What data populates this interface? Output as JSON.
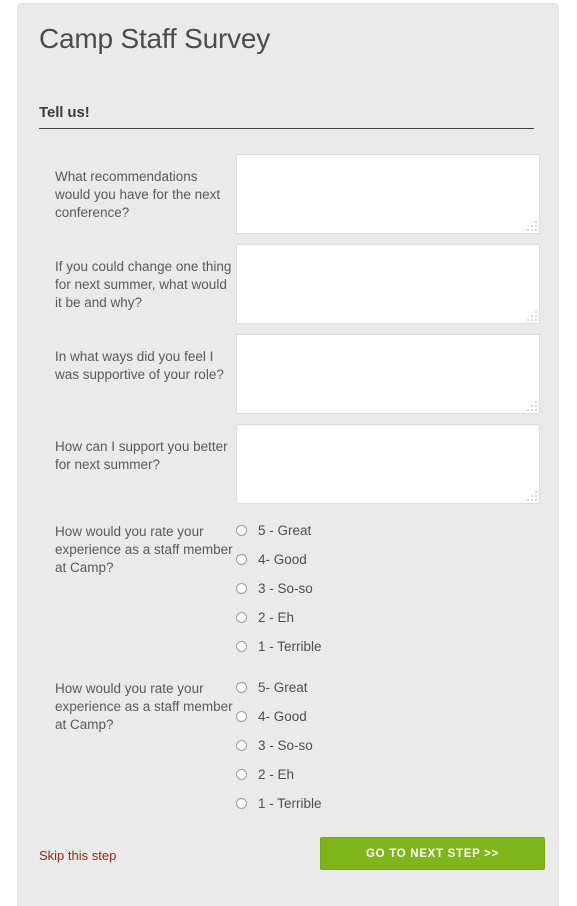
{
  "survey": {
    "title": "Camp Staff Survey",
    "section_title": "Tell us!"
  },
  "questions": [
    {
      "type": "textarea",
      "label": "What recommendations would you have for the next conference?",
      "value": "",
      "placeholder": ""
    },
    {
      "type": "textarea",
      "label": "If you could change one thing for next summer, what would it be and why?",
      "value": "",
      "placeholder": ""
    },
    {
      "type": "textarea",
      "label": "In what ways did you feel I was supportive of your role?",
      "value": "",
      "placeholder": ""
    },
    {
      "type": "textarea",
      "label": "How can I support you better for next summer?",
      "value": "",
      "placeholder": ""
    },
    {
      "type": "radio",
      "label": "How would you rate your experience as a staff member at Camp?",
      "selected": null,
      "options": [
        "5 - Great",
        "4- Good",
        "3 - So-so",
        "2 - Eh",
        "1 - Terrible"
      ]
    },
    {
      "type": "radio",
      "label": "How would you rate your experience as a staff member at Camp?",
      "selected": null,
      "options": [
        "5- Great",
        "4- Good",
        "3 - So-so",
        "2 - Eh",
        "1 - Terrible"
      ]
    }
  ],
  "footer": {
    "skip_label": "Skip this step",
    "next_label": "GO TO NEXT STEP >>"
  },
  "colors": {
    "panel_background": "#eaeaea",
    "title_text": "#4c4c4c",
    "question_text": "#5a5a5a",
    "rule": "#3f3f3f",
    "skip_link": "#8e2a1c",
    "next_button": "#7db51b",
    "next_button_text": "#ffffff",
    "textarea_background": "#ffffff",
    "textarea_border": "#dcdcdc",
    "radio_border": "#9a9a9a"
  }
}
